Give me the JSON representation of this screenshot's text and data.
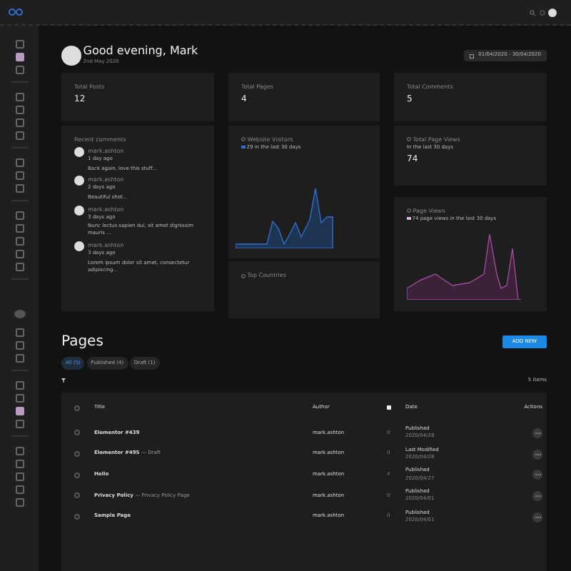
{
  "top_sidebar": {
    "groups": [
      [
        {
          "selected": false
        },
        {
          "selected": true
        },
        {
          "selected": false
        }
      ],
      [
        {
          "selected": false
        },
        {
          "selected": false
        },
        {
          "selected": false
        },
        {
          "selected": false
        }
      ],
      [
        {
          "selected": false
        },
        {
          "selected": false
        },
        {
          "selected": false
        }
      ],
      [
        {
          "selected": false
        },
        {
          "selected": false
        },
        {
          "selected": false
        },
        {
          "selected": false
        },
        {
          "selected": false
        }
      ]
    ]
  },
  "dashboard": {
    "greeting": "Good evening, Mark",
    "date": "2nd May 2020",
    "date_range": "01/04/2020 - 30/04/2020",
    "stats": [
      {
        "label": "Total Posts",
        "value": "12"
      },
      {
        "label": "Total Pages",
        "value": "4"
      },
      {
        "label": "Total Comments",
        "value": "5"
      }
    ],
    "recent_comments": {
      "title": "Recent comments",
      "items": [
        {
          "author": "mark.ashton",
          "time": "1 day ago",
          "text": "Back again, love this stuff..."
        },
        {
          "author": "mark.ashton",
          "time": "2 days ago",
          "text": "Beautiful shot..."
        },
        {
          "author": "mark.ashton",
          "time": "3 days ago",
          "text": "Nunc lectus sapien dui, sit amet dignissim mauris ..."
        },
        {
          "author": "mark.ashton",
          "time": "3 days ago",
          "text": "Lorem ipsum dolor sit amet, consectetur adipiscing..."
        }
      ]
    },
    "website_visitors": {
      "title": "Website Visitors",
      "summary": "29 in the last 30 days"
    },
    "total_page_views": {
      "title": "Total Page Views",
      "subtitle": "In the last 30 days",
      "value": "74"
    },
    "page_views": {
      "title": "Page Views",
      "summary": "74 page views in the last 30 days"
    },
    "top_countries": {
      "title": "Top Countries"
    }
  },
  "bottom_sidebar": {
    "groups": [
      [
        {
          "selected": false
        },
        {
          "selected": false
        },
        {
          "selected": false
        }
      ],
      [
        {
          "selected": false
        },
        {
          "selected": false
        },
        {
          "selected": true
        },
        {
          "selected": false
        }
      ],
      [
        {
          "selected": false
        },
        {
          "selected": false
        },
        {
          "selected": false
        },
        {
          "selected": false
        },
        {
          "selected": false
        }
      ]
    ]
  },
  "pages": {
    "title": "Pages",
    "add_button": "ADD NEW",
    "filters": [
      {
        "label": "All (5)",
        "selected": true
      },
      {
        "label": "Published (4)",
        "selected": false
      },
      {
        "label": "Draft (1)",
        "selected": false
      }
    ],
    "items_count": "5 items",
    "table": {
      "header_checked": false,
      "columns": [
        {
          "kind": "text",
          "label": "Title"
        },
        {
          "kind": "text",
          "label": "Author"
        },
        {
          "kind": "icon"
        },
        {
          "kind": "text",
          "label": "Date"
        },
        {
          "kind": "text",
          "label": "Actions"
        }
      ],
      "rows": [
        {
          "checked": false,
          "title": "Elementor #439",
          "author": "mark.ashton",
          "comments": "0",
          "status": "Published",
          "date": "2020/04/28"
        },
        {
          "checked": false,
          "title": "Elementor #495",
          "title_note": "— Draft",
          "author": "mark.ashton",
          "comments": "0",
          "status": "Last Modified",
          "date": "2020/04/28"
        },
        {
          "checked": false,
          "title": "Hello",
          "author": "mark.ashton",
          "comments": "4",
          "status": "Published",
          "date": "2020/04/27"
        },
        {
          "checked": false,
          "title": "Privacy Policy",
          "title_note": "— Privacy Policy Page",
          "author": "mark.ashton",
          "comments": "0",
          "status": "Published",
          "date": "2020/04/01"
        },
        {
          "checked": false,
          "title": "Sample Page",
          "author": "mark.ashton",
          "comments": "0",
          "status": "Published",
          "date": "2020/04/01"
        }
      ]
    }
  }
}
